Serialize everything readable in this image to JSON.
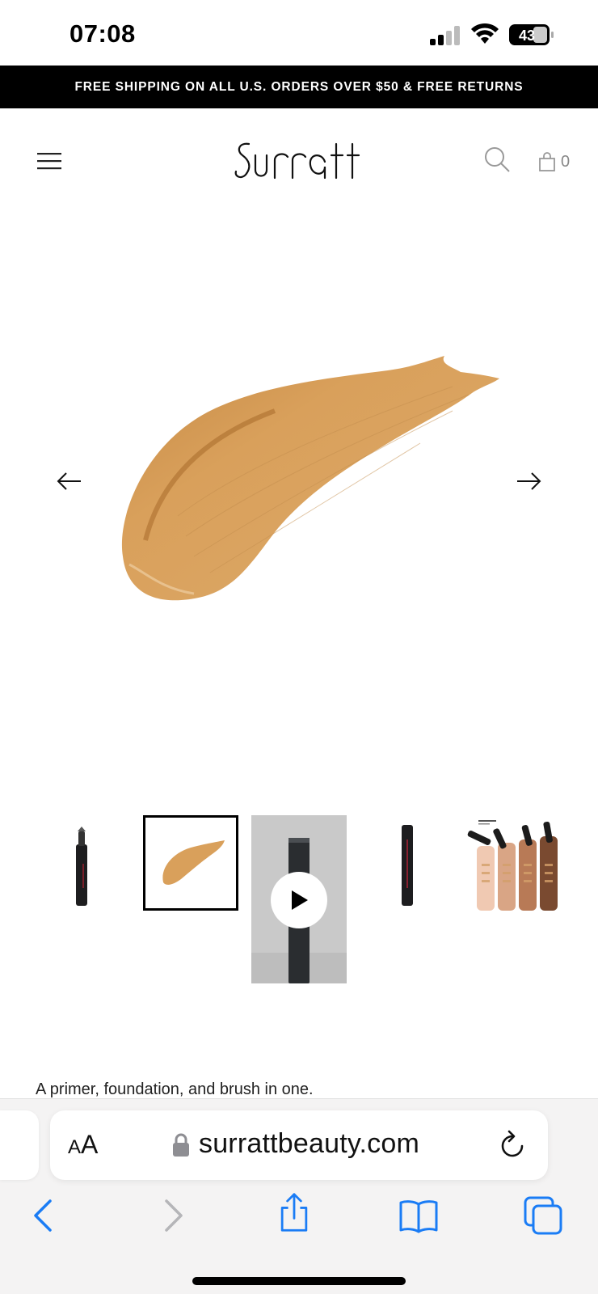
{
  "status_bar": {
    "time": "07:08",
    "battery_level": "43"
  },
  "promo_banner": {
    "text": "FREE SHIPPING ON ALL U.S. ORDERS OVER $50 & FREE RETURNS"
  },
  "header": {
    "logo_text": "surratt",
    "cart_count": "0"
  },
  "gallery": {
    "thumbnails": [
      {
        "name": "product-tube-side"
      },
      {
        "name": "swatch",
        "selected": true
      },
      {
        "name": "video",
        "video": true
      },
      {
        "name": "product-tube-front"
      },
      {
        "name": "arm-swatches"
      }
    ]
  },
  "product": {
    "description": "A primer, foundation, and brush in one."
  },
  "browser": {
    "aa_label_small": "A",
    "aa_label_large": "A",
    "url": "surrattbeauty.com"
  },
  "colors": {
    "swatch": "#d9a05b",
    "swatch_dark": "#b47a38",
    "ios_blue": "#1a7cf5",
    "promo_bg": "#000000"
  }
}
